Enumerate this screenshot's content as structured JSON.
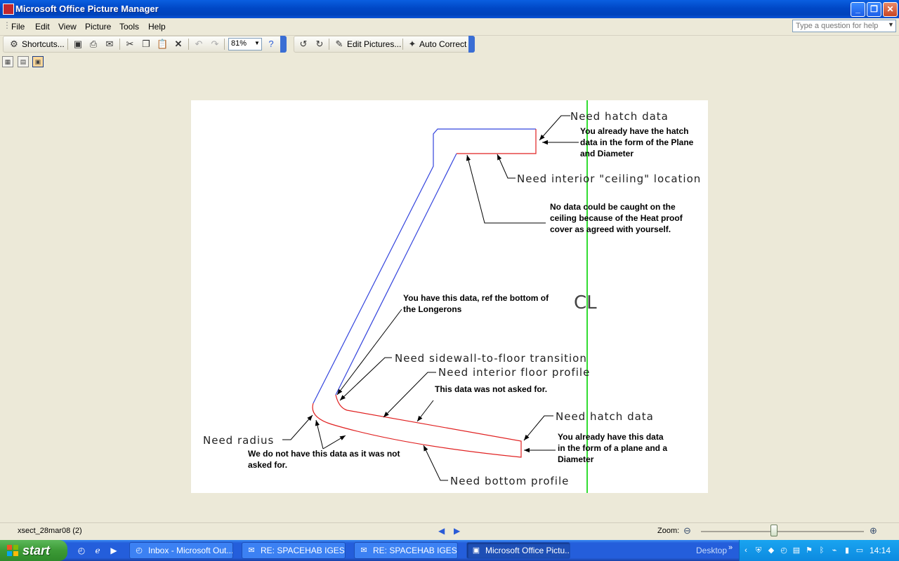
{
  "window": {
    "title": "Microsoft Office Picture Manager",
    "controls": {
      "minimize": "_",
      "maximize": "❐",
      "close": "✕"
    }
  },
  "menu": {
    "items": [
      "File",
      "Edit",
      "View",
      "Picture",
      "Tools",
      "Help"
    ],
    "help_placeholder": "Type a question for help"
  },
  "toolbar": {
    "shortcuts_label": "Shortcuts...",
    "zoom_value": "81%",
    "edit_pictures_label": "Edit Pictures...",
    "auto_correct_label": "Auto Correct"
  },
  "drawing": {
    "cad_labels": {
      "need_hatch_top": "Need hatch data",
      "need_ceiling": "Need interior \"ceiling\" location",
      "cl": "CL",
      "need_sidewall": "Need sidewall-to-floor transition",
      "need_floor": "Need interior floor profile",
      "need_hatch_bottom": "Need hatch data",
      "need_radius": "Need radius",
      "need_bottom": "Need bottom profile"
    },
    "annotations": {
      "hatch_top": "You already have the hatch data in the form of the Plane and Diameter",
      "ceiling": "No data could be caught on the ceiling because of the Heat proof cover as agreed with yourself.",
      "longerons": "You have this data, ref the bottom of the Longerons",
      "floor_not_asked": "This data was not asked for.",
      "hatch_bottom": "You already have this data in the form of a plane and a Diameter",
      "radius_not_asked": "We do not have this data as it was not asked for."
    },
    "colors": {
      "outer_line": "#3344dd",
      "inner_line": "#e02020",
      "centerline": "#33dd33"
    }
  },
  "status": {
    "file_name": "xsect_28mar08 (2)",
    "zoom_label": "Zoom:"
  },
  "taskbar": {
    "start_label": "start",
    "tasks": [
      "Inbox - Microsoft Out...",
      "RE: SPACEHAB IGES ...",
      "RE: SPACEHAB IGES ...",
      "Microsoft Office Pictu..."
    ],
    "desktop_label": "Desktop",
    "clock": "14:14"
  }
}
